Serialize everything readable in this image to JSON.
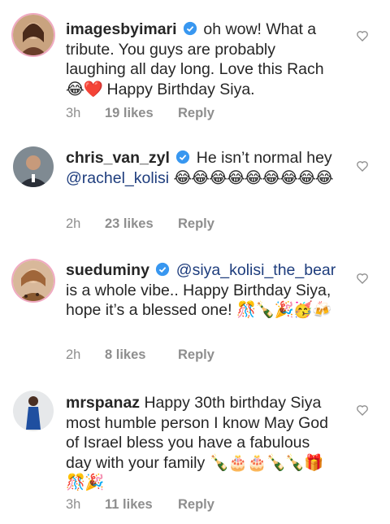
{
  "comments": [
    {
      "username": "imagesbyimari",
      "verified": true,
      "text_parts": [
        {
          "t": "oh wow! What a tribute. You guys are probably laughing all day long. Love this Rach "
        },
        {
          "e": "😂❤️"
        },
        {
          "t": " Happy Birthday Siya."
        }
      ],
      "time": "3h",
      "likes": "19 likes",
      "reply": "Reply"
    },
    {
      "username": "chris_van_zyl",
      "verified": true,
      "text_parts": [
        {
          "t": "He isn’t normal hey "
        },
        {
          "m": "@rachel_kolisi"
        },
        {
          "t": " "
        },
        {
          "e": "😂😂😂😂😂😂😂😂😂"
        }
      ],
      "time": "2h",
      "likes": "23 likes",
      "reply": "Reply"
    },
    {
      "username": "sueduminy",
      "verified": true,
      "text_parts": [
        {
          "m": "@siya_kolisi_the_bear"
        },
        {
          "t": " is a whole vibe.. Happy Birthday Siya, hope it’s a blessed one! "
        },
        {
          "e": "🎊🍾🎉🥳🍻"
        }
      ],
      "time": "2h",
      "likes": "8 likes",
      "reply": "Reply"
    },
    {
      "username": "mrspanaz",
      "verified": false,
      "text_parts": [
        {
          "t": "Happy 30th birthday Siya  most humble person I know May God of Israel bless you have a fabulous day with your family "
        },
        {
          "e": "🍾🎂🎂🍾🍾🎁🎊🎉"
        }
      ],
      "time": "3h",
      "likes": "11 likes",
      "reply": "Reply"
    }
  ],
  "colors": {
    "text": "#262626",
    "meta": "#8e8e8e",
    "mention": "#1e3d7d",
    "verified": "#3897f0"
  },
  "icons": {
    "like": "heart-outline-icon",
    "verified": "verified-badge-icon"
  }
}
